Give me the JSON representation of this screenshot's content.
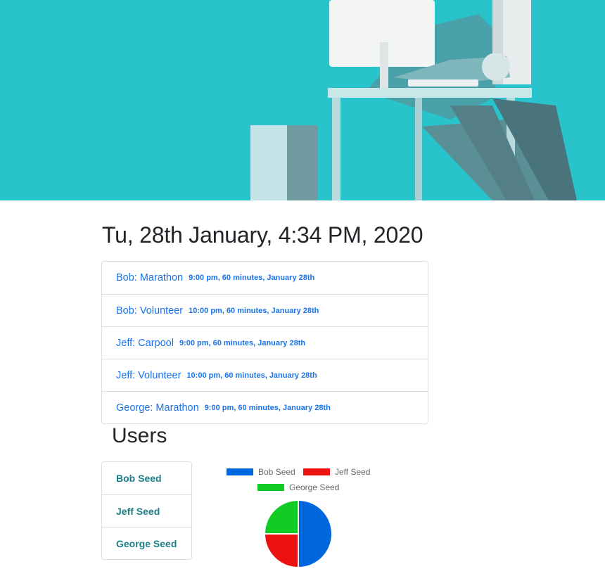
{
  "header": {
    "date_title": "Tu, 28th January, 4:34 PM, 2020"
  },
  "events": [
    {
      "title": "Bob: Marathon",
      "meta": "9:00 pm, 60 minutes, January 28th"
    },
    {
      "title": "Bob: Volunteer",
      "meta": "10:00 pm, 60 minutes, January 28th"
    },
    {
      "title": "Jeff: Carpool",
      "meta": "9:00 pm, 60 minutes, January 28th"
    },
    {
      "title": "Jeff: Volunteer",
      "meta": "10:00 pm, 60 minutes, January 28th"
    },
    {
      "title": "George: Marathon",
      "meta": "9:00 pm, 60 minutes, January 28th"
    }
  ],
  "users": {
    "title": "Users",
    "items": [
      {
        "label": "Bob Seed"
      },
      {
        "label": "Jeff Seed"
      },
      {
        "label": "George Seed"
      }
    ]
  },
  "chart_data": {
    "type": "pie",
    "title": "",
    "legend_position": "top",
    "categories": [
      "Bob Seed",
      "Jeff Seed",
      "George Seed"
    ],
    "values": [
      2,
      1,
      1
    ],
    "colors": [
      "#0066dd",
      "#ee1111",
      "#11cc22"
    ]
  }
}
